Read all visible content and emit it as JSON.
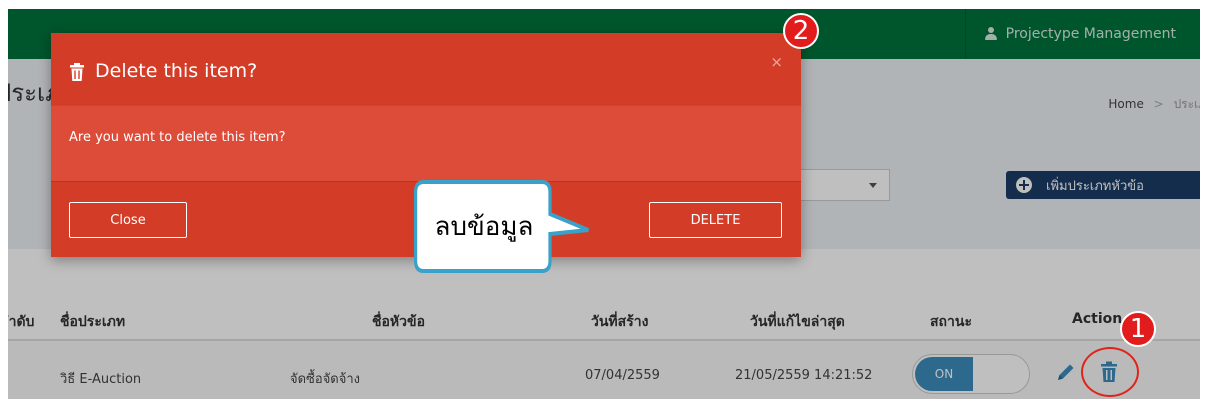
{
  "header": {
    "user_label": "Projectype Management"
  },
  "page": {
    "title": "ประเภท",
    "breadcrumb": {
      "home": "Home",
      "separator": ">",
      "current": "ประเภท"
    }
  },
  "toolbar": {
    "add_button": "เพิ่มประเภทหัวข้อ"
  },
  "table": {
    "columns": [
      "ลำดับ",
      "ชื่อประเภท",
      "ชื่อหัวข้อ",
      "วันที่สร้าง",
      "วันที่แก้ไขล่าสุด",
      "สถานะ",
      "Action"
    ],
    "rows": [
      {
        "type_name": "วิธี E-Auction",
        "topic_name": "จัดซื้อจัดจ้าง",
        "created": "07/04/2559",
        "modified": "21/05/2559 14:21:52",
        "status": "ON"
      }
    ]
  },
  "modal": {
    "title": "Delete this item?",
    "close_x": "×",
    "message": "Are you want to delete this item?",
    "close_button": "Close",
    "delete_button": "DELETE"
  },
  "annotations": {
    "callout_text": "ลบข้อมูล",
    "step1": "1",
    "step2": "2"
  },
  "colors": {
    "topbar": "#00733b",
    "modal_header": "#d33d28",
    "modal_body": "#dd4b39",
    "toggle_on": "#3c8dbc",
    "add_button": "#1c3d66",
    "marker": "#e21c1c"
  }
}
